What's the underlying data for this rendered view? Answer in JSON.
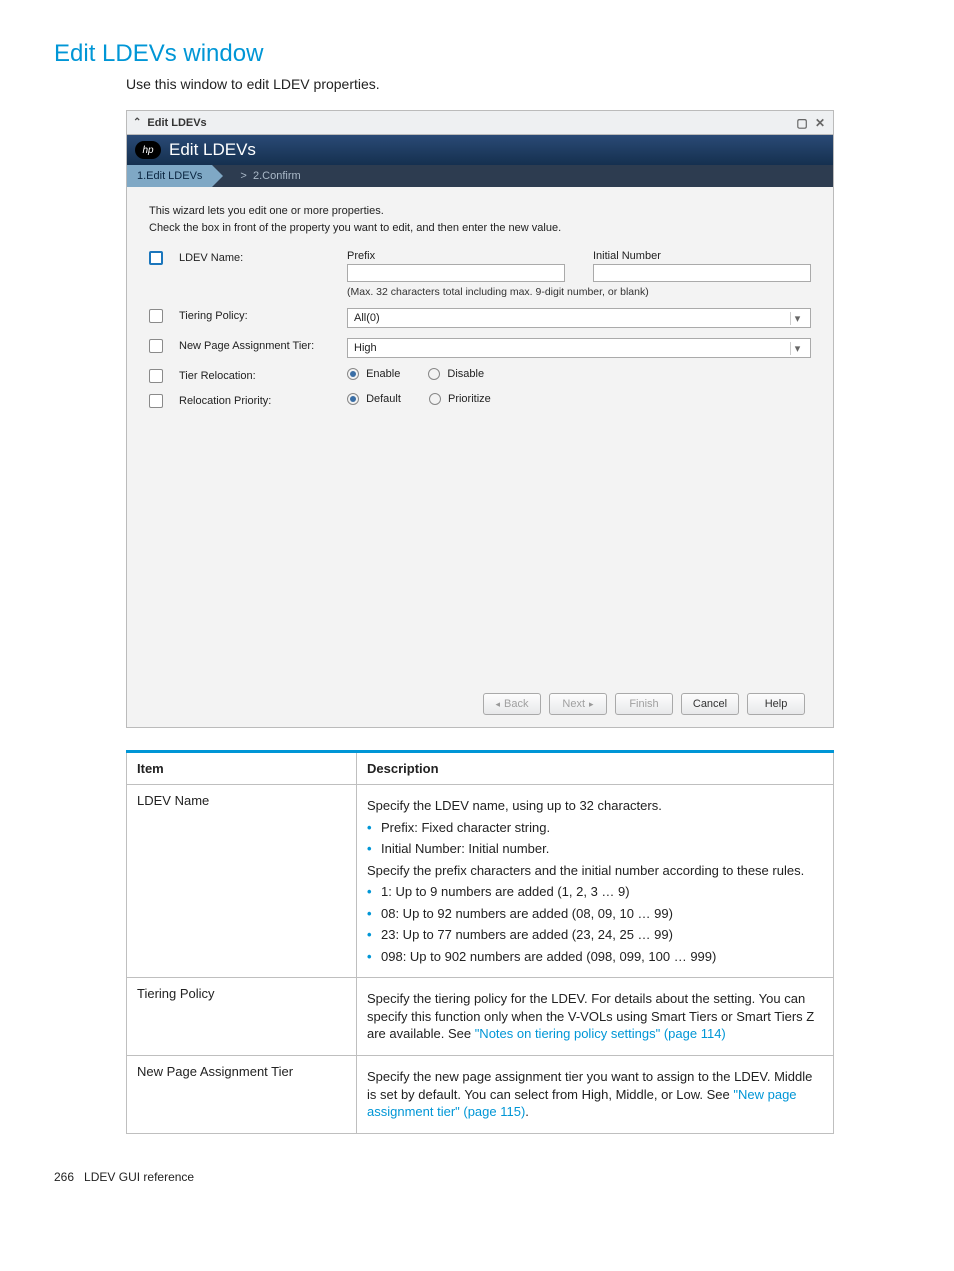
{
  "page": {
    "title": "Edit LDEVs window",
    "subtitle": "Use this window to edit LDEV properties.",
    "footer_page": "266",
    "footer_section": "LDEV GUI reference"
  },
  "wizard": {
    "titlebar": "Edit LDEVs",
    "header": "Edit LDEVs",
    "steps": {
      "s1": "1.Edit LDEVs",
      "s2": "2.Confirm"
    },
    "instr1": "This wizard lets you edit one or more properties.",
    "instr2": "Check the  box in front of the property you want to edit, and then enter the new value.",
    "ldev_name": {
      "label": "LDEV Name:",
      "prefix_label": "Prefix",
      "initial_label": "Initial Number",
      "hint": "(Max. 32 characters total including max. 9-digit number, or blank)"
    },
    "tiering_policy": {
      "label": "Tiering Policy:",
      "value": "All(0)"
    },
    "new_page_tier": {
      "label": "New Page Assignment Tier:",
      "value": "High"
    },
    "tier_relocation": {
      "label": "Tier Relocation:",
      "opt1": "Enable",
      "opt2": "Disable"
    },
    "reloc_priority": {
      "label": "Relocation Priority:",
      "opt1": "Default",
      "opt2": "Prioritize"
    },
    "buttons": {
      "back": "Back",
      "next": "Next",
      "finish": "Finish",
      "cancel": "Cancel",
      "help": "Help"
    }
  },
  "table": {
    "h_item": "Item",
    "h_desc": "Description",
    "r1": {
      "item": "LDEV Name",
      "p1": "Specify the LDEV name, using up to 32 characters.",
      "b1": "Prefix: Fixed character string.",
      "b2": "Initial Number: Initial number.",
      "p2": "Specify the prefix characters and the initial number according to these rules.",
      "b3": "1: Up to 9 numbers are added (1, 2, 3 … 9)",
      "b4": "08: Up to 92 numbers are added (08, 09, 10 … 99)",
      "b5": "23: Up to 77 numbers are added (23, 24, 25 … 99)",
      "b6": "098: Up to 902 numbers are added (098, 099, 100 … 999)"
    },
    "r2": {
      "item": "Tiering Policy",
      "p_a": "Specify the tiering policy for the LDEV. For details about the setting. You can specify this function only when the V-VOLs using Smart Tiers or Smart Tiers Z are available. See ",
      "link": "\"Notes on tiering policy settings\" (page 114)"
    },
    "r3": {
      "item": "New Page Assignment Tier",
      "p_a": "Specify the new page assignment tier you want to assign to the LDEV. Middle is set by default. You can select from High, Middle, or Low. See ",
      "link": "\"New page assignment tier\" (page 115)",
      "p_b": "."
    }
  }
}
